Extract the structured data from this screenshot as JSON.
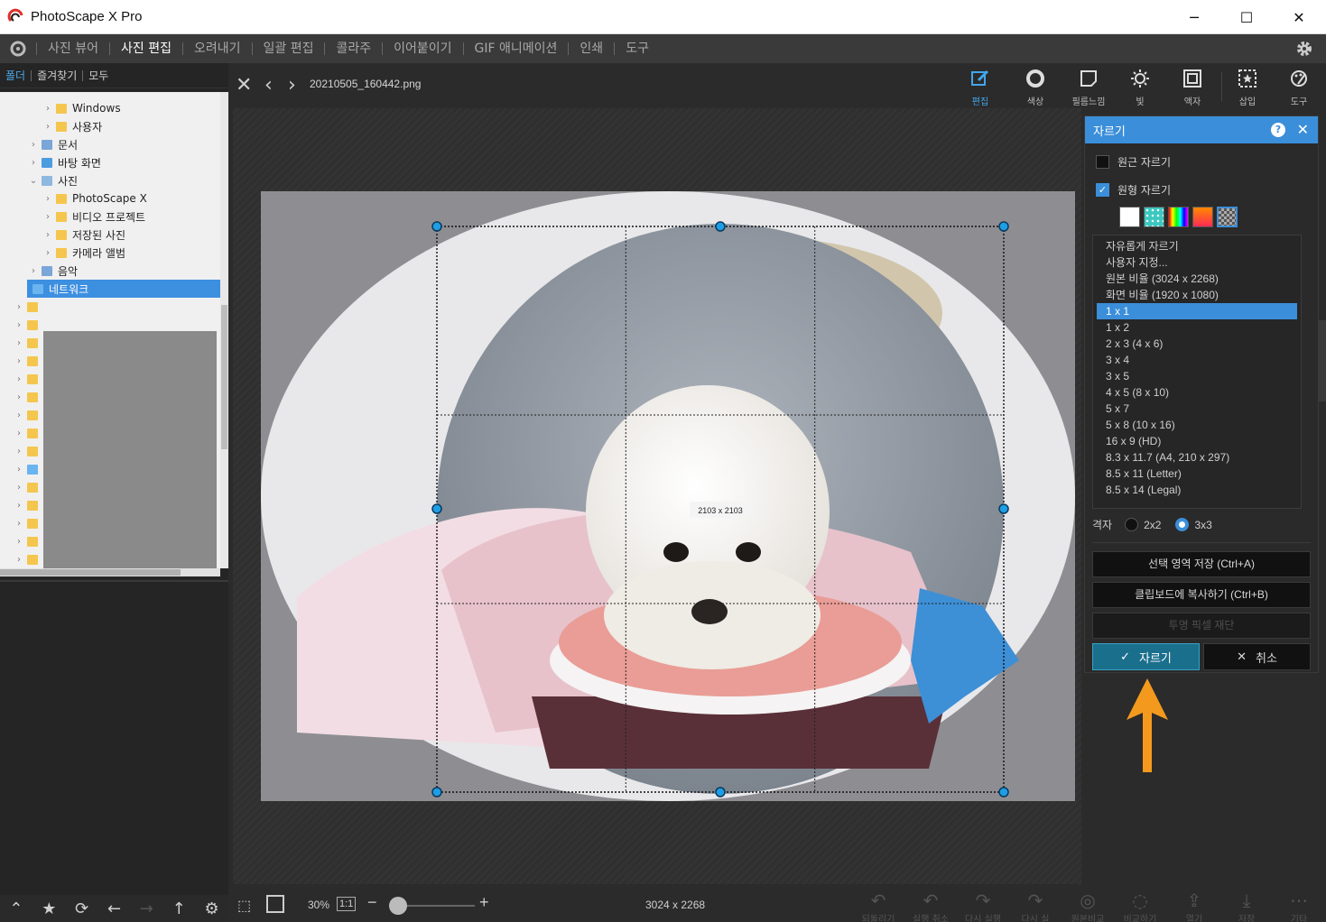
{
  "window": {
    "title": "PhotoScape X Pro",
    "minimize": "─",
    "maximize": "☐",
    "close": "✕"
  },
  "menu": {
    "items": [
      "사진 뷰어",
      "사진 편집",
      "오려내기",
      "일괄 편집",
      "콜라주",
      "이어붙이기",
      "GIF 애니메이션",
      "인쇄",
      "도구"
    ],
    "active_index": 1
  },
  "left_panel": {
    "tabs": [
      "폴더",
      "즐겨찾기",
      "모두"
    ],
    "tree": [
      {
        "label": "Windows",
        "indent": 2
      },
      {
        "label": "사용자",
        "indent": 2
      },
      {
        "label": "문서",
        "indent": 1
      },
      {
        "label": "바탕 화면",
        "indent": 1
      },
      {
        "label": "사진",
        "indent": 1,
        "expanded": true
      },
      {
        "label": "PhotoScape X",
        "indent": 2
      },
      {
        "label": "비디오 프로젝트",
        "indent": 2
      },
      {
        "label": "저장된 사진",
        "indent": 2
      },
      {
        "label": "카메라 앨범",
        "indent": 2
      },
      {
        "label": "음악",
        "indent": 1
      },
      {
        "label": "네트워크",
        "indent": 0,
        "selected": true
      }
    ]
  },
  "editor": {
    "filename": "20210505_160442.png",
    "tools": [
      {
        "label": "편집",
        "icon": "edit-icon",
        "active": true
      },
      {
        "label": "색상",
        "icon": "color-icon"
      },
      {
        "label": "필름느낌",
        "icon": "film-icon"
      },
      {
        "label": "빛",
        "icon": "light-icon"
      },
      {
        "label": "액자",
        "icon": "frame-icon"
      },
      {
        "label": "삽입",
        "icon": "insert-icon"
      },
      {
        "label": "도구",
        "icon": "tools-icon"
      }
    ],
    "selection_size": "2103 x 2103"
  },
  "crop_panel": {
    "title": "자르기",
    "help": "?",
    "options": [
      {
        "label": "원근 자르기",
        "checked": false
      },
      {
        "label": "원형 자르기",
        "checked": true
      }
    ],
    "swatch_colors": [
      "#ffffff",
      "#3cc8c0",
      "rainbow",
      "#ff2a55",
      "checker"
    ],
    "ratios": [
      "자유롭게 자르기",
      "사용자 지정...",
      "원본 비율 (3024 x 2268)",
      "화면 비율 (1920 x 1080)",
      "1 x 1",
      "1 x 2",
      "2 x 3 (4 x 6)",
      "3 x 4",
      "3 x 5",
      "4 x 5 (8 x 10)",
      "5 x 7",
      "5 x 8 (10 x 16)",
      "16 x 9 (HD)",
      "8.3 x 11.7 (A4, 210 x 297)",
      "8.5 x 11 (Letter)",
      "8.5 x 14 (Legal)"
    ],
    "selected_ratio_index": 4,
    "grid_label": "격자",
    "grid_options": [
      "2x2",
      "3x3"
    ],
    "grid_selected": "3x3",
    "save_selection": "선택 영역 저장 (Ctrl+A)",
    "copy_clipboard": "클립보드에 복사하기 (Ctrl+B)",
    "trim_transparent": "투명 픽셀 재단",
    "crop_button": "자르기",
    "cancel_button": "취소"
  },
  "bottom": {
    "zoom": "30%",
    "one_to_one": "1:1",
    "minus": "−",
    "plus": "+",
    "image_size": "3024 x 2268",
    "actions": [
      "되돌리기",
      "실행 취소",
      "다시 실행",
      "다시 실",
      "원본비교",
      "비교하기",
      "열기",
      "저장",
      "기타"
    ]
  },
  "colors": {
    "accent": "#3b8ed9",
    "crop_btn": "#1a6f8c",
    "arrow": "#f39a1e",
    "handle": "#1e9ee6"
  }
}
